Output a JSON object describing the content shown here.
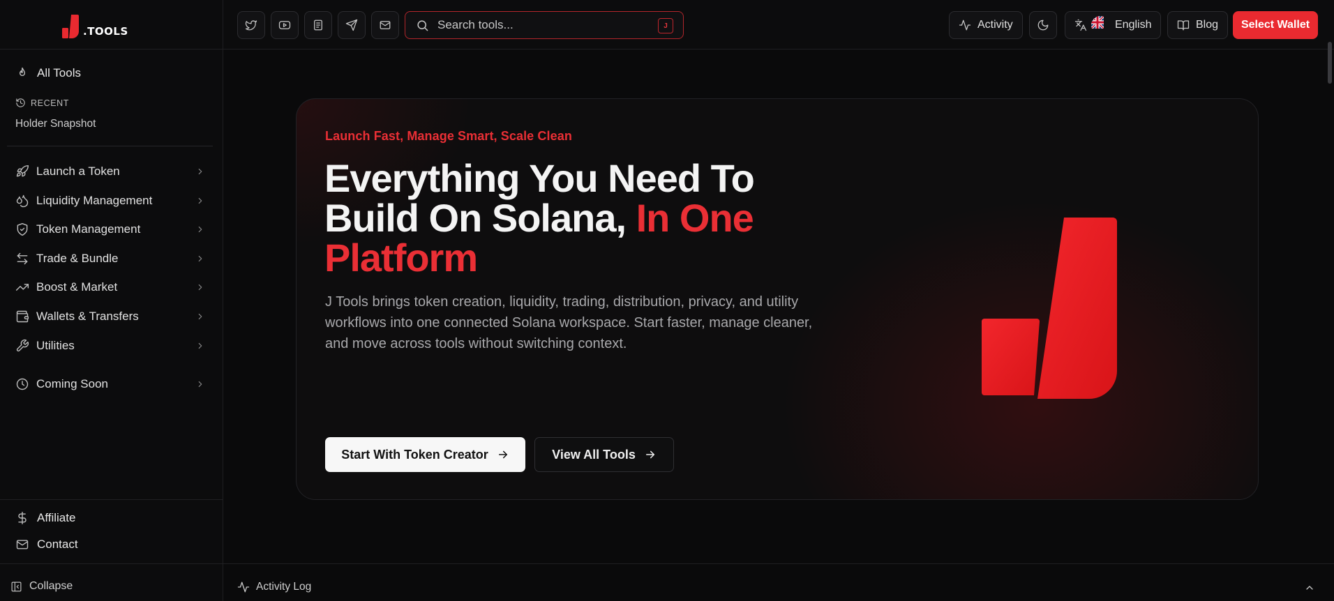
{
  "brand": {
    "logo_text": ".TOOLS",
    "accent_color": "#ea2f35"
  },
  "sidebar": {
    "all_tools_label": "All Tools",
    "recent_label": "RECENT",
    "recent_items": [
      "Holder Snapshot"
    ],
    "categories": [
      {
        "label": "Launch a Token",
        "icon": "rocket-icon"
      },
      {
        "label": "Liquidity Management",
        "icon": "droplets-icon"
      },
      {
        "label": "Token Management",
        "icon": "shield-check-icon"
      },
      {
        "label": "Trade & Bundle",
        "icon": "arrows-swap-icon"
      },
      {
        "label": "Boost & Market",
        "icon": "trending-up-icon"
      },
      {
        "label": "Wallets & Transfers",
        "icon": "wallet-icon"
      },
      {
        "label": "Utilities",
        "icon": "wrench-icon"
      },
      {
        "label": "Coming Soon",
        "icon": "clock-icon"
      }
    ],
    "affiliate_label": "Affiliate",
    "contact_label": "Contact",
    "collapse_label": "Collapse"
  },
  "header": {
    "social_icons": [
      "twitter-icon",
      "youtube-icon",
      "docs-icon",
      "telegram-icon",
      "mail-icon"
    ],
    "search": {
      "placeholder": "Search tools...",
      "shortcut": "J"
    },
    "activity_label": "Activity",
    "language_label": "English",
    "blog_label": "Blog",
    "wallet_label": "Select Wallet"
  },
  "hero": {
    "tagline": "Launch Fast, Manage Smart, Scale Clean",
    "headline_main": "Everything You Need To Build On Solana,",
    "headline_highlight": "In One Platform",
    "description": "J Tools brings token creation, liquidity, trading, distribution, privacy, and utility workflows into one connected Solana workspace. Start faster, manage cleaner, and move across tools without switching context.",
    "primary_cta": "Start With Token Creator",
    "secondary_cta": "View All Tools"
  },
  "activity_log": {
    "label": "Activity Log"
  }
}
